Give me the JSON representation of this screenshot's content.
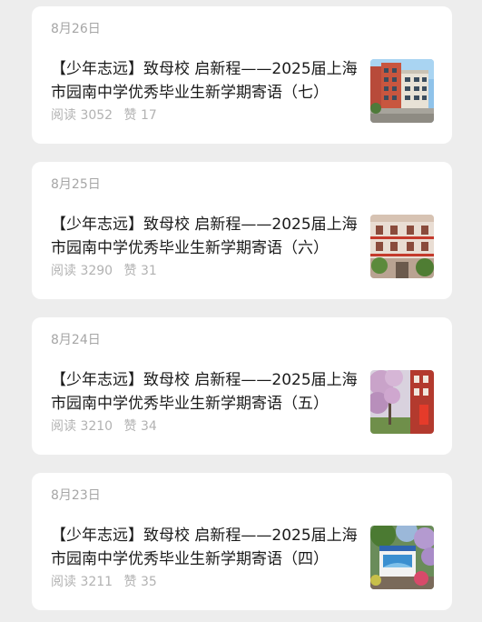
{
  "articles": [
    {
      "date": "8月26日",
      "title": "【少年志远】致母校 启新程——2025届上海市园南中学优秀毕业生新学期寄语（七）",
      "read_count": "阅读 3052",
      "like_count": "赞 17",
      "thumbnail_icon": "school-building-photo"
    },
    {
      "date": "8月25日",
      "title": "【少年志远】致母校 启新程——2025届上海市园南中学优秀毕业生新学期寄语（六）",
      "read_count": "阅读 3290",
      "like_count": "赞 31",
      "thumbnail_icon": "building-facade-photo"
    },
    {
      "date": "8月24日",
      "title": "【少年志远】致母校 启新程——2025届上海市园南中学优秀毕业生新学期寄语（五）",
      "read_count": "阅读 3210",
      "like_count": "赞 34",
      "thumbnail_icon": "campus-trees-photo"
    },
    {
      "date": "8月23日",
      "title": "【少年志远】致母校 启新程——2025届上海市园南中学优秀毕业生新学期寄语（四）",
      "read_count": "阅读 3211",
      "like_count": "赞 35",
      "thumbnail_icon": "campus-sign-photo"
    }
  ],
  "colors": {
    "background": "#ededed",
    "card": "#ffffff",
    "title_text": "#1a1a1a",
    "meta_text": "#b2b2b2"
  }
}
